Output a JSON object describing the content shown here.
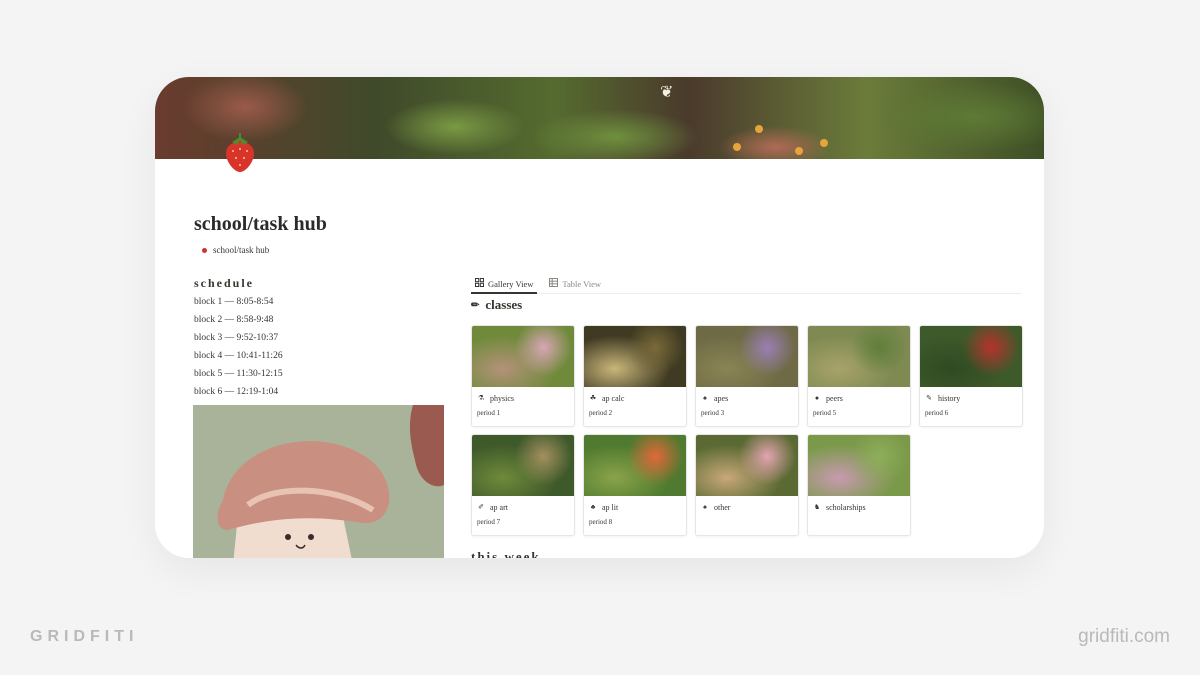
{
  "page": {
    "title": "school/task hub",
    "breadcrumb": "school/task hub",
    "page_icon": "strawberry-icon"
  },
  "schedule": {
    "heading": "schedule",
    "blocks": [
      "block 1 — 8:05-8:54",
      "block 2 — 8:58-9:48",
      "block 3 — 9:52-10:37",
      "block 4 — 10:41-11:26",
      "block 5 — 11:30-12:15",
      "block 6 — 12:19-1:04"
    ]
  },
  "views": {
    "tabs": [
      {
        "label": "Gallery View",
        "icon": "gallery-icon",
        "active": true
      },
      {
        "label": "Table View",
        "icon": "table-icon",
        "active": false
      }
    ]
  },
  "classes": {
    "heading": "classes",
    "heading_icon": "pencil-icon",
    "items": [
      {
        "name": "physics",
        "period": "period 1",
        "icon": "test-tube-icon",
        "emoji": "⚗",
        "thumb": [
          "#6f8a3a",
          "#b4927a",
          "#d8a6b5"
        ]
      },
      {
        "name": "ap calc",
        "period": "period 2",
        "icon": "leaf-icon",
        "emoji": "☘",
        "thumb": [
          "#3f3a22",
          "#c9b67a",
          "#7a6a3a"
        ]
      },
      {
        "name": "apes",
        "period": "period 3",
        "icon": "mushroom-icon",
        "emoji": "♠",
        "thumb": [
          "#6e6a45",
          "#8a8555",
          "#9a7fb5"
        ]
      },
      {
        "name": "peers",
        "period": "period 5",
        "icon": "pebble-icon",
        "emoji": "●",
        "thumb": [
          "#7e8a52",
          "#a8a36a",
          "#5f7f3a"
        ]
      },
      {
        "name": "history",
        "period": "period 6",
        "icon": "scroll-icon",
        "emoji": "✎",
        "thumb": [
          "#3e5a2a",
          "#2f4a22",
          "#b5322d"
        ]
      },
      {
        "name": "ap art",
        "period": "period 7",
        "icon": "brush-icon",
        "emoji": "✐",
        "thumb": [
          "#3f5a2a",
          "#6f8a3a",
          "#a49060"
        ]
      },
      {
        "name": "ap lit",
        "period": "period 8",
        "icon": "bear-icon",
        "emoji": "♣",
        "thumb": [
          "#4f7a2f",
          "#8aa34a",
          "#e2683a"
        ]
      },
      {
        "name": "other",
        "period": "",
        "icon": "mushroom-icon",
        "emoji": "♠",
        "thumb": [
          "#5a6a32",
          "#c9a87a",
          "#e3a5b0"
        ]
      },
      {
        "name": "scholarships",
        "period": "",
        "icon": "horse-icon",
        "emoji": "♞",
        "thumb": [
          "#7a9a4a",
          "#c89ab0",
          "#8fae5a"
        ]
      }
    ]
  },
  "this_week": {
    "heading": "this week"
  },
  "branding": {
    "left": "GRIDFITI",
    "right": "gridfiti.com"
  },
  "colors": {
    "accent_red": "#d2322d",
    "background": "#f4f4f4",
    "card": "#ffffff"
  }
}
